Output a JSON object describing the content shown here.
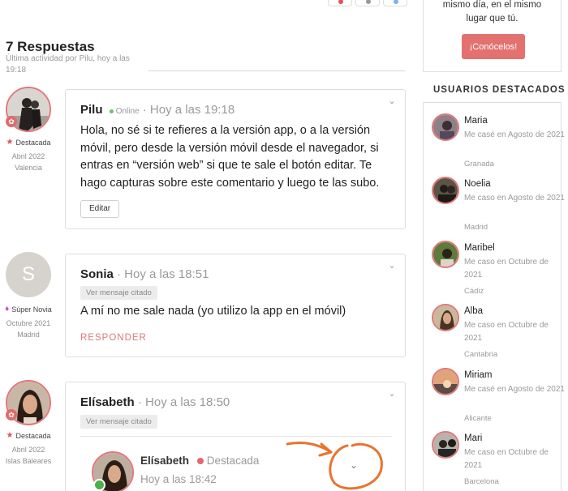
{
  "thread": {
    "title": "7 Respuestas",
    "last_activity": "Última actividad por Pilu, hoy a las 19:18"
  },
  "posts": [
    {
      "author": "Pilu",
      "status": "Online",
      "time": "· Hoy a las 19:18",
      "badge": "Destacada",
      "joined": "Abril 2022",
      "location": "Valencia",
      "body": "Hola, no sé si te refieres a la versión app, o a la versión móvil, pero desde la versión móvil desde el navegador, si entras en “versión web” si que te sale el botón editar. Te hago capturas sobre este comentario y luego te las subo.",
      "edit_label": "Editar"
    },
    {
      "author": "Sonia",
      "time": "· Hoy a las 18:51",
      "avatar_letter": "S",
      "badge": "Súper Novia",
      "joined": "Octubre 2021",
      "location": "Madrid",
      "quoted_label": "Ver mensaje citado",
      "body": "A mí no me sale nada (yo utilizo la app en el móvil)",
      "reply_label": "RESPONDER"
    },
    {
      "author": "Elísabeth",
      "time": "· Hoy a las 18:50",
      "badge": "Destacada",
      "joined": "Abril 2022",
      "location": "Islas Baleares",
      "quoted_label": "Ver mensaje citado",
      "quote": {
        "author": "Elísabeth",
        "badge": "Destacada",
        "time": "Hoy a las 18:42"
      }
    }
  ],
  "sidebar": {
    "promo_text": "mismo día, en el mismo lugar que tú.",
    "promo_button": "¡Conócelos!",
    "featured_title": "USUARIOS DESTACADOS",
    "featured": [
      {
        "name": "Maria",
        "sub": "Me casé en Agosto de 2021",
        "location": "Granada"
      },
      {
        "name": "Noelia",
        "sub": "Me caso en Agosto de 2021",
        "location": "Madrid"
      },
      {
        "name": "Maribel",
        "sub": "Me caso en Octubre de 2021",
        "location": "Cádiz"
      },
      {
        "name": "Alba",
        "sub": "Me caso en Octubre de 2021",
        "location": "Cantabria"
      },
      {
        "name": "Miriam",
        "sub": "Me casé en Agosto de 2021",
        "location": "Alicante"
      },
      {
        "name": "Mari",
        "sub": "Me caso en Octubre de 2021",
        "location": "Barcelona"
      }
    ]
  },
  "colors": {
    "accent": "#e0787a",
    "button": "#e3716f",
    "online": "#6cc06c",
    "annotation": "#e8742e"
  },
  "icons": [
    "chevron-down-icon",
    "star-icon",
    "diamond-icon",
    "share-icon"
  ]
}
